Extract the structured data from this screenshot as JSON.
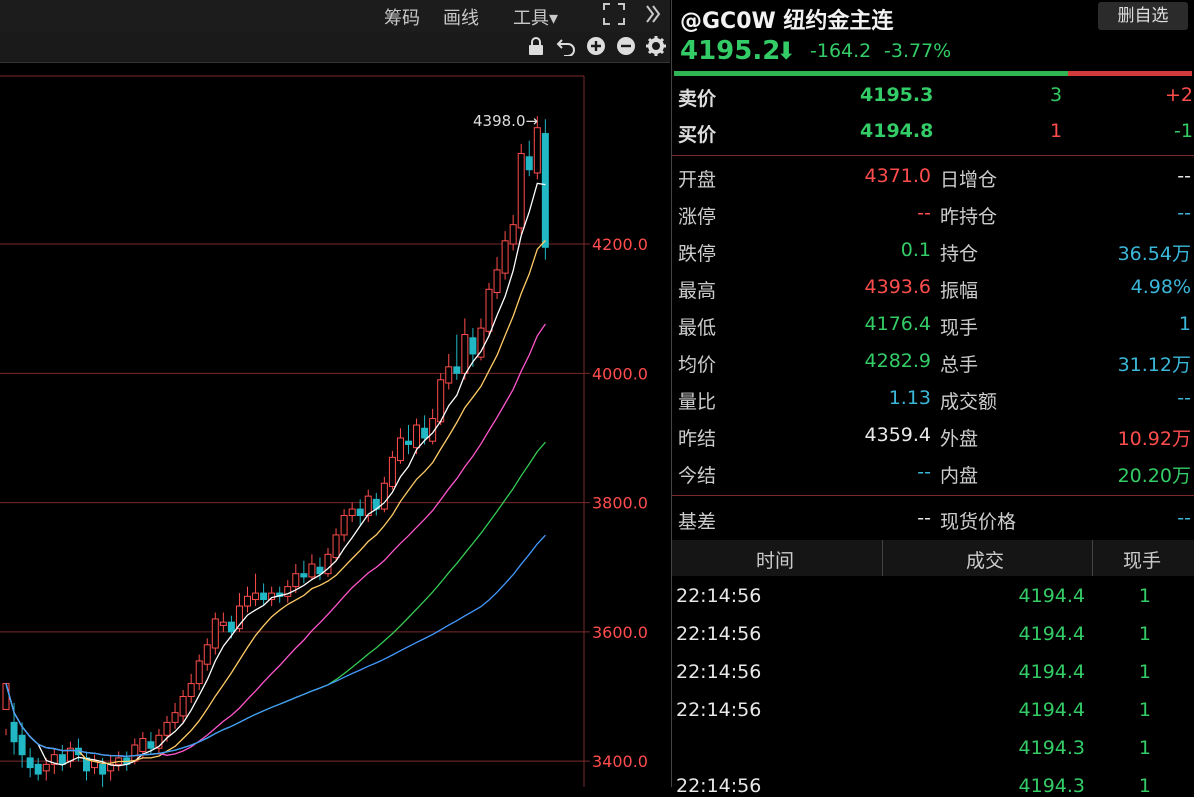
{
  "toolbar": {
    "chip_label": "筹码",
    "draw_label": "画线",
    "tools_label": "工具▾",
    "fullscreen_icon": "fullscreen-icon",
    "more_icon": "double-chevron-right-icon"
  },
  "chart_toolbar": {
    "icons": [
      "lock-icon",
      "undo-icon",
      "zoom-in-icon",
      "zoom-out-icon",
      "gear-icon"
    ]
  },
  "chart_data": {
    "type": "candlestick",
    "high_annotation": "4398.0→",
    "y_ticks": [
      "4200.0",
      "4000.0",
      "3800.0",
      "3600.0",
      "3400.0"
    ],
    "y_tick_values": [
      4200,
      4000,
      3800,
      3600,
      3400
    ],
    "ylim": [
      3360,
      4460
    ],
    "candles": [
      [
        3480,
        3520,
        3450,
        3440
      ],
      [
        3460,
        3430,
        3490,
        3410
      ],
      [
        3440,
        3410,
        3460,
        3390
      ],
      [
        3405,
        3390,
        3420,
        3375
      ],
      [
        3395,
        3380,
        3405,
        3370
      ],
      [
        3385,
        3395,
        3405,
        3370
      ],
      [
        3395,
        3410,
        3420,
        3380
      ],
      [
        3410,
        3395,
        3425,
        3385
      ],
      [
        3400,
        3420,
        3430,
        3390
      ],
      [
        3420,
        3410,
        3435,
        3400
      ],
      [
        3405,
        3385,
        3415,
        3370
      ],
      [
        3390,
        3400,
        3410,
        3380
      ],
      [
        3395,
        3380,
        3405,
        3360
      ],
      [
        3385,
        3395,
        3410,
        3370
      ],
      [
        3395,
        3405,
        3415,
        3385
      ],
      [
        3405,
        3395,
        3415,
        3385
      ],
      [
        3400,
        3425,
        3435,
        3395
      ],
      [
        3415,
        3435,
        3445,
        3405
      ],
      [
        3430,
        3420,
        3445,
        3410
      ],
      [
        3420,
        3440,
        3450,
        3410
      ],
      [
        3440,
        3460,
        3470,
        3430
      ],
      [
        3460,
        3475,
        3490,
        3450
      ],
      [
        3470,
        3500,
        3510,
        3460
      ],
      [
        3500,
        3520,
        3535,
        3490
      ],
      [
        3520,
        3555,
        3565,
        3510
      ],
      [
        3550,
        3580,
        3590,
        3540
      ],
      [
        3575,
        3620,
        3630,
        3565
      ],
      [
        3610,
        3615,
        3630,
        3600
      ],
      [
        3615,
        3600,
        3625,
        3590
      ],
      [
        3605,
        3640,
        3660,
        3600
      ],
      [
        3640,
        3655,
        3670,
        3630
      ],
      [
        3650,
        3660,
        3690,
        3640
      ],
      [
        3660,
        3650,
        3675,
        3640
      ],
      [
        3650,
        3660,
        3670,
        3640
      ],
      [
        3660,
        3655,
        3670,
        3645
      ],
      [
        3655,
        3670,
        3680,
        3645
      ],
      [
        3670,
        3690,
        3705,
        3660
      ],
      [
        3690,
        3685,
        3710,
        3675
      ],
      [
        3685,
        3705,
        3720,
        3680
      ],
      [
        3700,
        3690,
        3715,
        3680
      ],
      [
        3690,
        3720,
        3730,
        3685
      ],
      [
        3715,
        3750,
        3760,
        3710
      ],
      [
        3750,
        3780,
        3790,
        3740
      ],
      [
        3780,
        3790,
        3800,
        3770
      ],
      [
        3790,
        3780,
        3805,
        3765
      ],
      [
        3780,
        3810,
        3820,
        3770
      ],
      [
        3805,
        3790,
        3815,
        3780
      ],
      [
        3790,
        3830,
        3840,
        3785
      ],
      [
        3825,
        3870,
        3880,
        3820
      ],
      [
        3865,
        3900,
        3915,
        3860
      ],
      [
        3895,
        3890,
        3920,
        3875
      ],
      [
        3885,
        3920,
        3930,
        3875
      ],
      [
        3915,
        3900,
        3935,
        3890
      ],
      [
        3895,
        3930,
        3945,
        3890
      ],
      [
        3925,
        3990,
        4000,
        3920
      ],
      [
        3985,
        4010,
        4030,
        3975
      ],
      [
        4010,
        4000,
        4060,
        3990
      ],
      [
        4000,
        4060,
        4085,
        3990
      ],
      [
        4055,
        4030,
        4070,
        4010
      ],
      [
        4025,
        4070,
        4085,
        4020
      ],
      [
        4065,
        4130,
        4140,
        4060
      ],
      [
        4125,
        4160,
        4180,
        4115
      ],
      [
        4155,
        4205,
        4220,
        4145
      ],
      [
        4200,
        4230,
        4245,
        4190
      ],
      [
        4225,
        4340,
        4355,
        4215
      ],
      [
        4335,
        4315,
        4360,
        4305
      ],
      [
        4310,
        4380,
        4398,
        4300
      ],
      [
        4371,
        4195,
        4393,
        4176
      ]
    ],
    "ma_series": [
      {
        "color": "#ffffff",
        "name": "MA5"
      },
      {
        "color": "#ffcc66",
        "name": "MA10"
      },
      {
        "color": "#ff55cc",
        "name": "MA20"
      },
      {
        "color": "#33cc55",
        "name": "MA40"
      },
      {
        "color": "#4499ff",
        "name": "MA60"
      }
    ]
  },
  "quote": {
    "title": "@GC0W 纽约金主连",
    "delete_label": "删自选",
    "price": "4195.2",
    "change": "-164.2",
    "change_pct": "-3.77%",
    "buy_ratio": 0.76
  },
  "book": {
    "ask": {
      "label": "卖价",
      "price": "4195.3",
      "qty": "3",
      "delta": "+2"
    },
    "bid": {
      "label": "买价",
      "price": "4194.8",
      "qty": "1",
      "delta": "-1"
    }
  },
  "stats": [
    {
      "l1": "开盘",
      "v1": "4371.0",
      "c1": "red",
      "l2": "日增仓",
      "v2": "--",
      "c2": "white"
    },
    {
      "l1": "涨停",
      "v1": "--",
      "c1": "red",
      "l2": "昨持仓",
      "v2": "--",
      "c2": "cyan"
    },
    {
      "l1": "跌停",
      "v1": "0.1",
      "c1": "green",
      "l2": "持仓",
      "v2": "36.54万",
      "c2": "cyan"
    },
    {
      "l1": "最高",
      "v1": "4393.6",
      "c1": "red",
      "l2": "振幅",
      "v2": "4.98%",
      "c2": "cyan"
    },
    {
      "l1": "最低",
      "v1": "4176.4",
      "c1": "green",
      "l2": "现手",
      "v2": "1",
      "c2": "cyan"
    },
    {
      "l1": "均价",
      "v1": "4282.9",
      "c1": "green",
      "l2": "总手",
      "v2": "31.12万",
      "c2": "cyan"
    },
    {
      "l1": "量比",
      "v1": "1.13",
      "c1": "cyan",
      "l2": "成交额",
      "v2": "--",
      "c2": "cyan"
    },
    {
      "l1": "昨结",
      "v1": "4359.4",
      "c1": "white",
      "l2": "外盘",
      "v2": "10.92万",
      "c2": "red"
    },
    {
      "l1": "今结",
      "v1": "--",
      "c1": "cyan",
      "l2": "内盘",
      "v2": "20.20万",
      "c2": "green"
    }
  ],
  "basis": {
    "l1": "基差",
    "v1": "--",
    "l2": "现货价格",
    "v2": "--"
  },
  "ticks_table": {
    "headers": [
      "时间",
      "成交",
      "现手"
    ],
    "rows": [
      {
        "time": "22:14:56",
        "price": "4194.4",
        "vol": "1"
      },
      {
        "time": "22:14:56",
        "price": "4194.4",
        "vol": "1"
      },
      {
        "time": "22:14:56",
        "price": "4194.4",
        "vol": "1"
      },
      {
        "time": "22:14:56",
        "price": "4194.4",
        "vol": "1"
      },
      {
        "time": "",
        "price": "4194.3",
        "vol": "1"
      },
      {
        "time": "22:14:56",
        "price": "4194.3",
        "vol": "1"
      }
    ]
  }
}
